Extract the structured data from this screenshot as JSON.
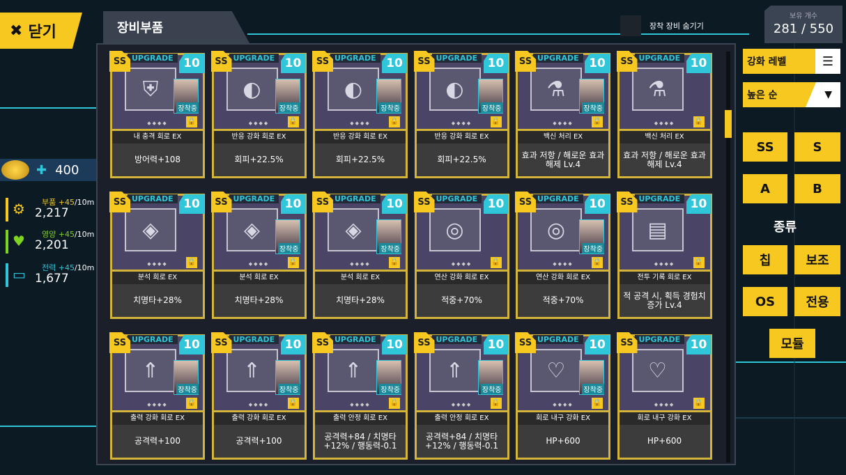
{
  "close": {
    "icon": "close-icon",
    "label": "닫기"
  },
  "title": "장비부품",
  "hide_equipped": "장착 장비 숨기기",
  "count": {
    "label": "보유 개수",
    "value": "281 / 550"
  },
  "power": {
    "value": "400"
  },
  "resources": [
    {
      "name": "부품",
      "rate": "+45",
      "unit": "/10m",
      "value": "2,217",
      "color": "#f6c820",
      "icon": "gear-icon"
    },
    {
      "name": "영양",
      "rate": "+45",
      "unit": "/10m",
      "value": "2,201",
      "color": "#7ed321",
      "icon": "heart-icon"
    },
    {
      "name": "전력",
      "rate": "+45",
      "unit": "/10m",
      "value": "1,677",
      "color": "#2ec6d8",
      "icon": "battery-icon"
    }
  ],
  "sort": {
    "label": "강화 레벨",
    "order": "높은 순"
  },
  "rank_filters": [
    "SS",
    "S",
    "A",
    "B"
  ],
  "type_label": "종류",
  "type_filters": [
    "칩",
    "보조",
    "OS",
    "전용",
    "모듈"
  ],
  "upgrade_text": "UPGRADE",
  "rank_badge": "SS",
  "equipped_text": "장착중",
  "items": [
    {
      "name": "내 충격 회로 EX",
      "effect": "방어력+108",
      "level": "10",
      "equipped": true
    },
    {
      "name": "반응 강화 회로 EX",
      "effect": "회피+22.5%",
      "level": "10",
      "equipped": true
    },
    {
      "name": "반응 강화 회로 EX",
      "effect": "회피+22.5%",
      "level": "10",
      "equipped": true
    },
    {
      "name": "반응 강화 회로 EX",
      "effect": "회피+22.5%",
      "level": "10",
      "equipped": true
    },
    {
      "name": "백신 처리 EX",
      "effect": "효과 저항 / 해로운 효과 해제 Lv.4",
      "level": "10",
      "equipped": true
    },
    {
      "name": "백신 처리 EX",
      "effect": "효과 저항 / 해로운 효과 해제 Lv.4",
      "level": "10",
      "equipped": false
    },
    {
      "name": "분석 회로 EX",
      "effect": "치명타+28%",
      "level": "10",
      "equipped": false
    },
    {
      "name": "분석 회로 EX",
      "effect": "치명타+28%",
      "level": "10",
      "equipped": true
    },
    {
      "name": "분석 회로 EX",
      "effect": "치명타+28%",
      "level": "10",
      "equipped": true
    },
    {
      "name": "연산 강화 회로 EX",
      "effect": "적중+70%",
      "level": "10",
      "equipped": false
    },
    {
      "name": "연산 강화 회로 EX",
      "effect": "적중+70%",
      "level": "10",
      "equipped": true
    },
    {
      "name": "전투 기록 회로 EX",
      "effect": "적 공격 시, 획득 경험치 증가 Lv.4",
      "level": "10",
      "equipped": false
    },
    {
      "name": "출력 강화 회로 EX",
      "effect": "공격력+100",
      "level": "10",
      "equipped": true
    },
    {
      "name": "출력 강화 회로 EX",
      "effect": "공격력+100",
      "level": "10",
      "equipped": true
    },
    {
      "name": "출력 안정 회로 EX",
      "effect": "공격력+84 / 치명타+12% / 행동력-0.1",
      "level": "10",
      "equipped": true
    },
    {
      "name": "출력 안정 회로 EX",
      "effect": "공격력+84 / 치명타+12% / 행동력-0.1",
      "level": "10",
      "equipped": true
    },
    {
      "name": "회로 내구 강화 EX",
      "effect": "HP+600",
      "level": "10",
      "equipped": true
    },
    {
      "name": "회로 내구 강화 EX",
      "effect": "HP+600",
      "level": "10",
      "equipped": false
    }
  ]
}
